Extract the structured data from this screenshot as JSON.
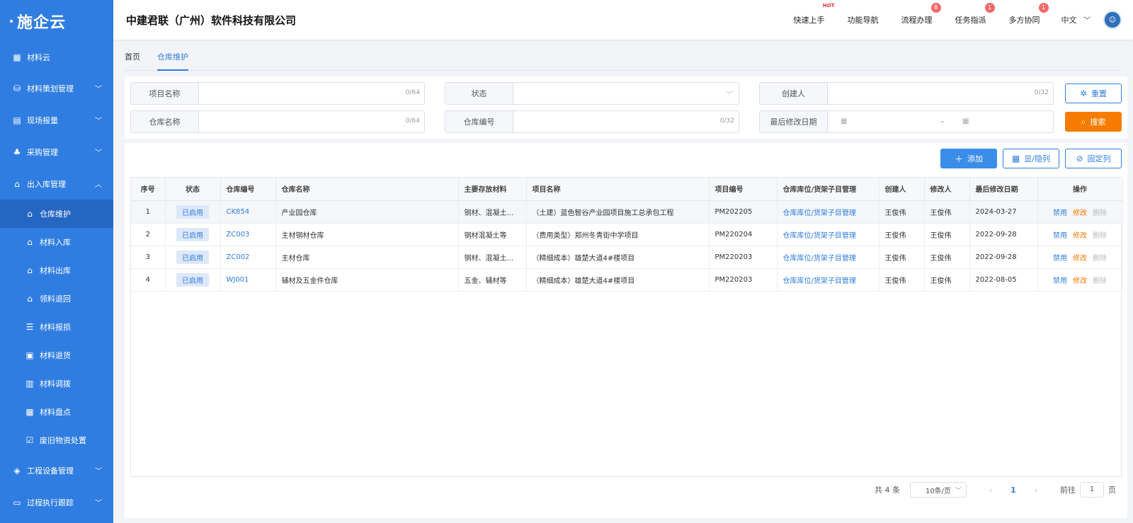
{
  "brand": {
    "logo_text": "施企云"
  },
  "sidebar": {
    "top_item": {
      "label": "材料云",
      "icon": "grid-icon"
    },
    "groups": [
      {
        "label": "材料策划管理",
        "icon": "database-icon"
      },
      {
        "label": "现场报量",
        "icon": "report-icon"
      },
      {
        "label": "采购管理",
        "icon": "org-icon"
      },
      {
        "label": "出入库管理",
        "icon": "warehouse-icon"
      }
    ],
    "sub_items": [
      {
        "label": "仓库维护",
        "icon": "home-icon"
      },
      {
        "label": "材料入库",
        "icon": "inbound-icon"
      },
      {
        "label": "材料出库",
        "icon": "outbound-icon"
      },
      {
        "label": "领料退回",
        "icon": "return-icon"
      },
      {
        "label": "材料报损",
        "icon": "list-icon"
      },
      {
        "label": "材料退货",
        "icon": "refund-icon"
      },
      {
        "label": "材料调拨",
        "icon": "transfer-icon"
      },
      {
        "label": "材料盘点",
        "icon": "inventory-icon"
      },
      {
        "label": "废旧物资处置",
        "icon": "clipboard-icon"
      }
    ],
    "bottom_groups": [
      {
        "label": "工程设备管理",
        "icon": "cube-icon"
      },
      {
        "label": "过程执行跟踪",
        "icon": "monitor-icon"
      }
    ]
  },
  "header": {
    "company": "中建君联（广州）软件科技有限公司",
    "items": [
      {
        "label": "快速上手",
        "badge": "HOT"
      },
      {
        "label": "功能导航",
        "badge": ""
      },
      {
        "label": "流程办理",
        "badge": "8"
      },
      {
        "label": "任务指派",
        "badge": "1"
      },
      {
        "label": "多方协同",
        "badge": "1"
      }
    ],
    "language": "中文"
  },
  "tabs": [
    {
      "label": "首页"
    },
    {
      "label": "仓库维护"
    }
  ],
  "search": {
    "project_name": {
      "label": "项目名称",
      "count": "0/64"
    },
    "status": {
      "label": "状态"
    },
    "creator": {
      "label": "创建人",
      "count": "0/32"
    },
    "warehouse_name": {
      "label": "仓库名称",
      "count": "0/64"
    },
    "warehouse_code": {
      "label": "仓库编号",
      "count": "0/32"
    },
    "last_modified": {
      "label": "最后修改日期",
      "sep": "-"
    },
    "reset_label": "重置",
    "search_label": "搜索"
  },
  "toolbar": {
    "add_label": "添加",
    "show_hide_label": "显/隐列",
    "fixed_col_label": "固定列"
  },
  "table": {
    "headers": [
      "序号",
      "状态",
      "仓库编号",
      "仓库名称",
      "主要存放材料",
      "项目名称",
      "项目编号",
      "仓库库位/货架子目管理",
      "创建人",
      "修改人",
      "最后修改日期",
      "操作"
    ],
    "rows": [
      {
        "no": "1",
        "status": "已启用",
        "code": "CK854",
        "name": "产业园仓库",
        "material": "钢材、混凝土...",
        "project": "（土建）蓝色智谷产业园项目施工总承包工程",
        "project_code": "PM202205",
        "manage": "仓库库位/货架子目管理",
        "creator": "王俊伟",
        "modifier": "王俊伟",
        "date": "2024-03-27",
        "op_disable": "禁用",
        "op_edit": "修改",
        "op_delete": "删除"
      },
      {
        "no": "2",
        "status": "已启用",
        "code": "ZC003",
        "name": "主材钢材仓库",
        "material": "钢材混凝土等",
        "project": "（费用类型）郑州冬青街中学项目",
        "project_code": "PM220204",
        "manage": "仓库库位/货架子目管理",
        "creator": "王俊伟",
        "modifier": "王俊伟",
        "date": "2022-09-28",
        "op_disable": "禁用",
        "op_edit": "修改",
        "op_delete": "删除"
      },
      {
        "no": "3",
        "status": "已启用",
        "code": "ZC002",
        "name": "主材仓库",
        "material": "钢材、混凝土...",
        "project": "（精细成本）雄楚大道4#楼项目",
        "project_code": "PM220203",
        "manage": "仓库库位/货架子目管理",
        "creator": "王俊伟",
        "modifier": "王俊伟",
        "date": "2022-09-28",
        "op_disable": "禁用",
        "op_edit": "修改",
        "op_delete": "删除"
      },
      {
        "no": "4",
        "status": "已启用",
        "code": "WJ001",
        "name": "辅材及五金件仓库",
        "material": "五金、辅材等",
        "project": "（精细成本）雄楚大道4#楼项目",
        "project_code": "PM220203",
        "manage": "仓库库位/货架子目管理",
        "creator": "王俊伟",
        "modifier": "王俊伟",
        "date": "2022-08-05",
        "op_disable": "禁用",
        "op_edit": "修改",
        "op_delete": "删除"
      }
    ]
  },
  "pagination": {
    "total": "共 4 条",
    "page_size": "10条/页",
    "current": "1",
    "goto_prefix": "前往",
    "goto_value": "1",
    "goto_suffix": "页"
  },
  "colors": {
    "primary": "#2f7de1",
    "accent": "#f57c00",
    "sidebar": "#2f7de1"
  }
}
